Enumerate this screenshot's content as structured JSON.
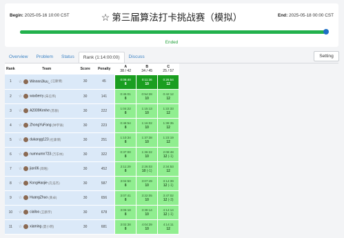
{
  "header": {
    "begin_label": "Begin:",
    "begin_value": "2025-05-16 10:00 CST",
    "title": "第三届算法打卡挑战赛（模拟）",
    "end_label": "End:",
    "end_value": "2025-05-18 00:00 CST",
    "status": "Ended",
    "progress_percent": 100
  },
  "tabs": [
    "Overview",
    "Problem",
    "Status",
    "Rank (1:14:00:00)",
    "Discuss"
  ],
  "active_tab": 3,
  "setting_label": "Setting",
  "table": {
    "headers": {
      "rank": "Rank",
      "team": "Team",
      "score": "Score",
      "penalty": "Penalty"
    },
    "problems": [
      {
        "letter": "A",
        "stat": "38 / 42"
      },
      {
        "letter": "B",
        "stat": "34 / 45"
      },
      {
        "letter": "C",
        "stat": "25 / 57"
      }
    ],
    "rows": [
      {
        "rank": "1",
        "team": "Winnnn3Iuu_",
        "cn": "(汪康博)",
        "score": "30",
        "penalty": "45",
        "cells": [
          {
            "time": "0:06:40",
            "score": "8",
            "tries": "",
            "first": true
          },
          {
            "time": "0:11:36",
            "score": "10",
            "tries": "",
            "first": true
          },
          {
            "time": "0:26:54",
            "score": "12",
            "tries": "",
            "first": true
          }
        ]
      },
      {
        "rank": "2",
        "team": "waxberry",
        "cn": "(朱信伟)",
        "score": "30",
        "penalty": "141",
        "cells": [
          {
            "time": "0:45:01",
            "score": "8",
            "tries": "",
            "first": false
          },
          {
            "time": "0:54:28",
            "score": "10",
            "tries": "",
            "first": false
          },
          {
            "time": "0:42:12",
            "score": "12",
            "tries": "",
            "first": false
          }
        ]
      },
      {
        "rank": "3",
        "team": "A2009Kenhe",
        "cn": "(苏赫)",
        "score": "30",
        "penalty": "222",
        "cells": [
          {
            "time": "1:04:22",
            "score": "8",
            "tries": "",
            "first": false
          },
          {
            "time": "1:15:13",
            "score": "10",
            "tries": "",
            "first": false
          },
          {
            "time": "1:22:33",
            "score": "12",
            "tries": "",
            "first": false
          }
        ]
      },
      {
        "rank": "4",
        "team": "ZhongYuFang",
        "cn": "(钟宇锋)",
        "score": "30",
        "penalty": "223",
        "cells": [
          {
            "time": "0:48:54",
            "score": "8",
            "tries": "",
            "first": false
          },
          {
            "time": "1:16:02",
            "score": "10",
            "tries": "",
            "first": false
          },
          {
            "time": "1:38:35",
            "score": "12",
            "tries": "",
            "first": false
          }
        ]
      },
      {
        "rank": "5",
        "team": "dukangg123",
        "cn": "(杜康博)",
        "score": "30",
        "penalty": "251",
        "cells": [
          {
            "time": "1:10:34",
            "score": "8",
            "tries": "",
            "first": false
          },
          {
            "time": "1:37:38",
            "score": "10",
            "tries": "",
            "first": false
          },
          {
            "time": "1:23:19",
            "score": "12",
            "tries": "",
            "first": false
          }
        ]
      },
      {
        "rank": "6",
        "team": "numnumrr723",
        "cn": "(万东林)",
        "score": "30",
        "penalty": "322",
        "cells": [
          {
            "time": "0:37:00",
            "score": "8",
            "tries": "",
            "first": false
          },
          {
            "time": "1:36:22",
            "score": "10",
            "tries": "",
            "first": false
          },
          {
            "time": "2:08:48",
            "score": "12",
            "tries": "(-1)",
            "first": false
          }
        ]
      },
      {
        "rank": "7",
        "team": "jian06",
        "cn": "(简略)",
        "score": "30",
        "penalty": "452",
        "cells": [
          {
            "time": "2:11:29",
            "score": "8",
            "tries": "",
            "first": false
          },
          {
            "time": "2:26:03",
            "score": "10",
            "tries": "(-1)",
            "first": false
          },
          {
            "time": "2:34:53",
            "score": "12",
            "tries": "",
            "first": false
          }
        ]
      },
      {
        "rank": "8",
        "team": "KongHaojie",
        "cn": "(孔浩杰)",
        "score": "30",
        "penalty": "587",
        "cells": [
          {
            "time": "3:04:50",
            "score": "8",
            "tries": "",
            "first": false
          },
          {
            "time": "3:07:49",
            "score": "10",
            "tries": "",
            "first": false
          },
          {
            "time": "3:14:39",
            "score": "12",
            "tries": "(-1)",
            "first": false
          }
        ]
      },
      {
        "rank": "9",
        "team": "HuangZhuo",
        "cn": "(黄卓)",
        "score": "30",
        "penalty": "656",
        "cells": [
          {
            "time": "3:07:41",
            "score": "8",
            "tries": "",
            "first": false
          },
          {
            "time": "3:22:05",
            "score": "10",
            "tries": "",
            "first": false
          },
          {
            "time": "3:47:02",
            "score": "12",
            "tries": "(-3)",
            "first": false
          }
        ]
      },
      {
        "rank": "10",
        "team": "cialloo",
        "cn": "(王鹏宇)",
        "score": "30",
        "penalty": "678",
        "cells": [
          {
            "time": "3:06:18",
            "score": "8",
            "tries": "",
            "first": false
          },
          {
            "time": "3:38:14",
            "score": "10",
            "tries": "",
            "first": false
          },
          {
            "time": "4:14:14",
            "score": "12",
            "tries": "(-1)",
            "first": false
          }
        ]
      },
      {
        "rank": "11",
        "team": "xiaming",
        "cn": "(夏小明)",
        "score": "30",
        "penalty": "681",
        "cells": [
          {
            "time": "3:02:38",
            "score": "8",
            "tries": "",
            "first": false
          },
          {
            "time": "4:04:39",
            "score": "10",
            "tries": "",
            "first": false
          },
          {
            "time": "4:14:11",
            "score": "12",
            "tries": "",
            "first": false
          }
        ]
      }
    ]
  },
  "colors": {
    "progress": "#22b14c",
    "progress_knob": "#1f6fc5",
    "accepted": "#90ee90",
    "first_blood": "#1a9e20",
    "team_bg": "#dbe9f8",
    "link": "#3b82c4"
  }
}
